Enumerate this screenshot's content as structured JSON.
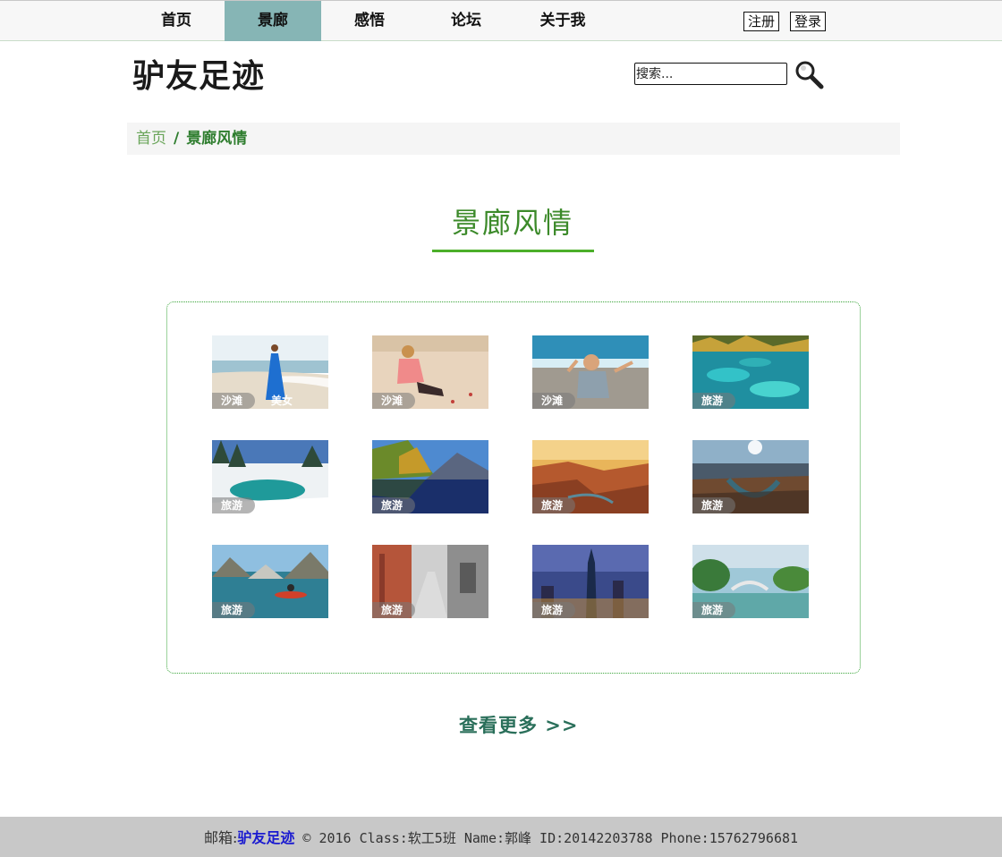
{
  "nav": {
    "items": [
      {
        "label": "首页"
      },
      {
        "label": "景廊"
      },
      {
        "label": "感悟"
      },
      {
        "label": "论坛"
      },
      {
        "label": "关于我"
      }
    ],
    "active_index": 1,
    "register_label": "注册",
    "login_label": "登录"
  },
  "header": {
    "logo_text": "驴友足迹",
    "search_placeholder": "搜索..."
  },
  "breadcrumb": {
    "home": "首页",
    "separator": "/",
    "current": "景廊风情"
  },
  "section": {
    "title": "景廊风情"
  },
  "gallery": {
    "items": [
      {
        "tag": "沙滩",
        "tag2": "美女",
        "scene": "beach-woman-blue-dress"
      },
      {
        "tag": "沙滩",
        "tag2": "",
        "scene": "beach-woman-pink"
      },
      {
        "tag": "沙滩",
        "tag2": "",
        "scene": "beach-woman-waving"
      },
      {
        "tag": "旅游",
        "tag2": "",
        "scene": "turquoise-lake"
      },
      {
        "tag": "旅游",
        "tag2": "",
        "scene": "snowy-forest-lake"
      },
      {
        "tag": "旅游",
        "tag2": "",
        "scene": "mountain-lake"
      },
      {
        "tag": "旅游",
        "tag2": "",
        "scene": "canyon-sunset"
      },
      {
        "tag": "旅游",
        "tag2": "",
        "scene": "horseshoe-bend"
      },
      {
        "tag": "旅游",
        "tag2": "",
        "scene": "lake-kayak"
      },
      {
        "tag": "旅游",
        "tag2": "",
        "scene": "old-street"
      },
      {
        "tag": "旅游",
        "tag2": "",
        "scene": "city-night"
      },
      {
        "tag": "旅游",
        "tag2": "",
        "scene": "park-bridge"
      }
    ]
  },
  "more_link": "查看更多 >>",
  "footer": {
    "email_label": "邮箱:",
    "brand": "驴友足迹",
    "info": " © 2016 Class:软工5班 Name:郭峰 ID:20142203788 Phone:15762796681"
  },
  "colors": {
    "nav_active_bg": "#86b5b5",
    "accent_green": "#4caf2a",
    "breadcrumb_current": "#2e7d2e",
    "footer_bg": "#c8c8c8",
    "footer_link": "#1a1ad0"
  }
}
